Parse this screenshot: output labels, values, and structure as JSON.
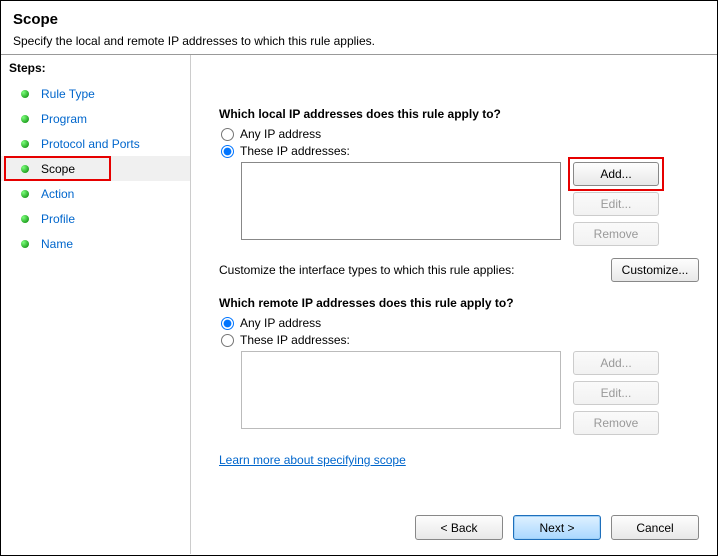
{
  "header": {
    "title": "Scope",
    "subtitle": "Specify the local and remote IP addresses to which this rule applies."
  },
  "sidebar": {
    "heading": "Steps:",
    "items": [
      {
        "label": "Rule Type"
      },
      {
        "label": "Program"
      },
      {
        "label": "Protocol and Ports"
      },
      {
        "label": "Scope"
      },
      {
        "label": "Action"
      },
      {
        "label": "Profile"
      },
      {
        "label": "Name"
      }
    ]
  },
  "content": {
    "local": {
      "heading": "Which local IP addresses does this rule apply to?",
      "opt_any": "Any IP address",
      "opt_these": "These IP addresses:",
      "btn_add": "Add...",
      "btn_edit": "Edit...",
      "btn_remove": "Remove"
    },
    "customize": {
      "text": "Customize the interface types to which this rule applies:",
      "btn": "Customize..."
    },
    "remote": {
      "heading": "Which remote IP addresses does this rule apply to?",
      "opt_any": "Any IP address",
      "opt_these": "These IP addresses:",
      "btn_add": "Add...",
      "btn_edit": "Edit...",
      "btn_remove": "Remove"
    },
    "learn_link": "Learn more about specifying scope"
  },
  "footer": {
    "back": "< Back",
    "next": "Next >",
    "cancel": "Cancel"
  }
}
